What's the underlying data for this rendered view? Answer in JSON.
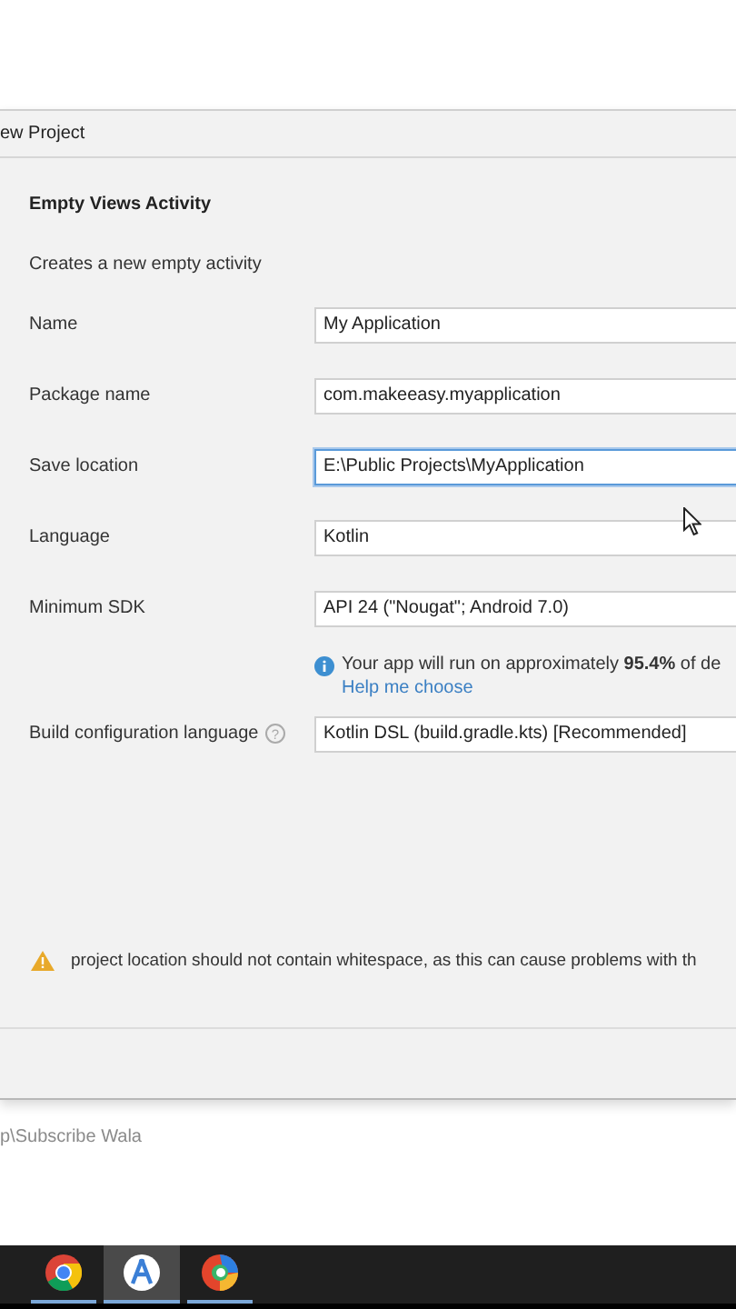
{
  "window": {
    "title": "ew Project"
  },
  "template": {
    "heading": "Empty Views Activity",
    "description": "Creates a new empty activity"
  },
  "fields": [
    {
      "label": "Name",
      "value": "My Application",
      "focused": false
    },
    {
      "label": "Package name",
      "value": "com.makeeasy.myapplication",
      "focused": false
    },
    {
      "label": "Save location",
      "value": "E:\\Public Projects\\MyApplication",
      "focused": true
    },
    {
      "label": "Language",
      "value": "Kotlin",
      "focused": false
    },
    {
      "label": "Minimum SDK",
      "value": "API 24 (\"Nougat\"; Android 7.0)",
      "focused": false
    }
  ],
  "sdk_info": {
    "text": "Your app will run on approximately **95.4%** of de",
    "link": "Help me choose"
  },
  "build_config": {
    "label": "Build configuration language",
    "value": "Kotlin DSL (build.gradle.kts) [Recommended]",
    "focused": false,
    "help_glyph": "?"
  },
  "warning": {
    "text": "project location should not contain whitespace, as this can cause problems with th"
  },
  "background_text": "p\\Subscribe Wala",
  "taskbar": [
    {
      "kind": "browser",
      "selected": false
    },
    {
      "kind": "studio",
      "selected": true
    },
    {
      "kind": "edge",
      "selected": false
    }
  ]
}
